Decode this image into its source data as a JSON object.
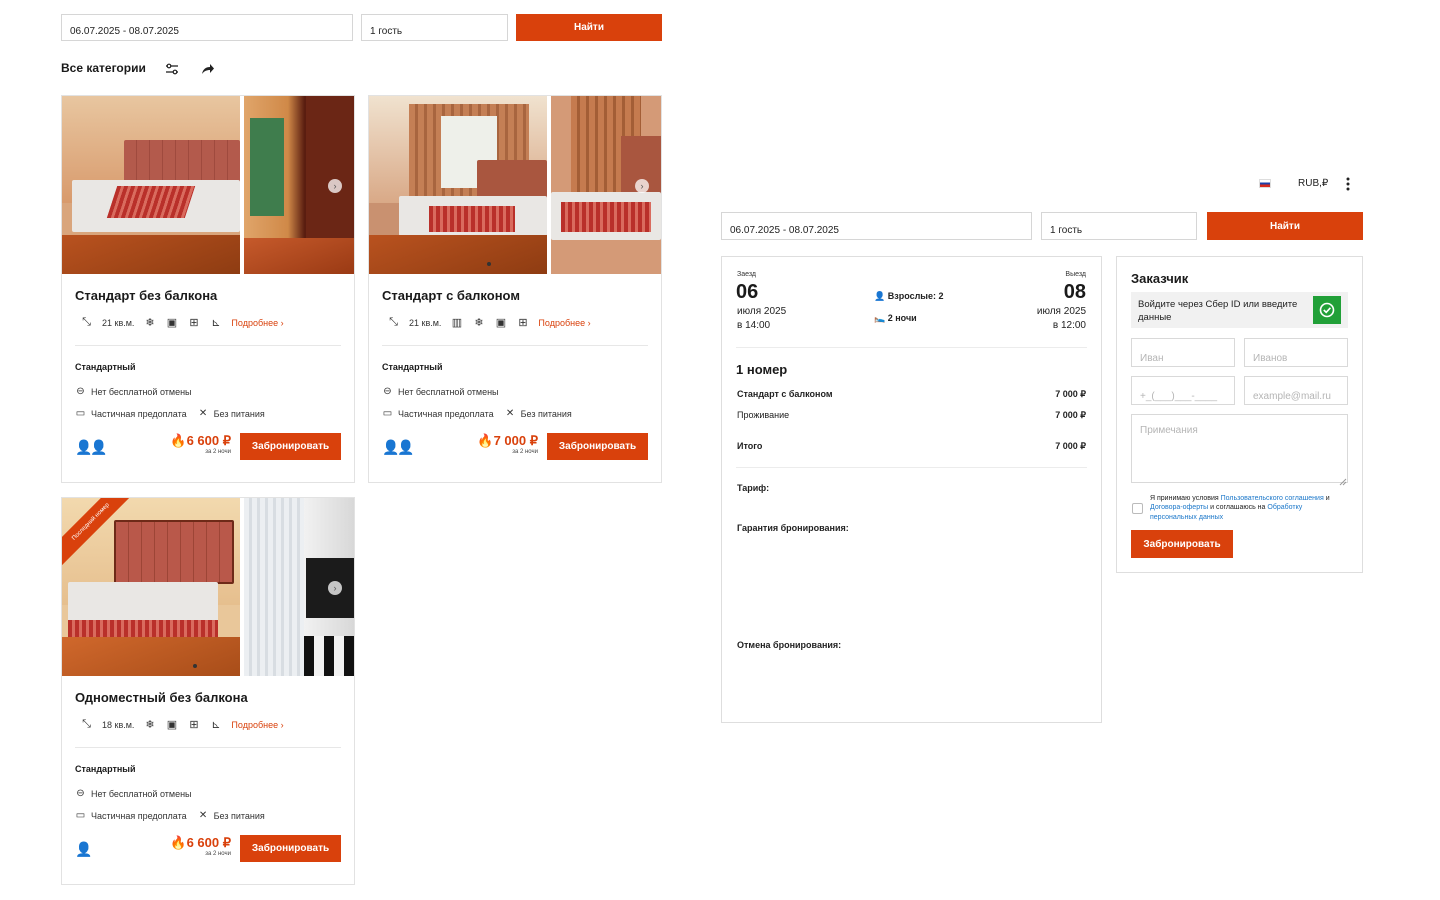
{
  "left_search": {
    "dates": "06.07.2025 - 08.07.2025",
    "guests": "1 гость",
    "find_label": "Найти"
  },
  "categories": {
    "title": "Все категории",
    "filter_icon": "sliders-icon",
    "share_icon": "share-arrow-icon"
  },
  "rooms": [
    {
      "title": "Стандарт без балкона",
      "area": "21 кв.м.",
      "amenity_icons": [
        "air-conditioner-icon",
        "safe-icon",
        "window-icon",
        "toilet-icon"
      ],
      "more": "Подробнее",
      "tariff": "Стандартный",
      "cancel": "Нет бесплатной отмены",
      "prepay": "Частичная предоплата",
      "meals": "Без питания",
      "guests_icons": "👥",
      "price": "6 600 ₽",
      "price_note": "за 2 ночи",
      "book": "Забронировать"
    },
    {
      "title": "Стандарт с балконом",
      "area": "21 кв.м.",
      "amenity_icons": [
        "balcony-icon",
        "air-conditioner-icon",
        "safe-icon",
        "window-icon"
      ],
      "more": "Подробнее",
      "tariff": "Стандартный",
      "cancel": "Нет бесплатной отмены",
      "prepay": "Частичная предоплата",
      "meals": "Без питания",
      "price": "7 000 ₽",
      "price_note": "за 2 ночи",
      "book": "Забронировать"
    },
    {
      "title": "Одноместный без балкона",
      "area": "18 кв.м.",
      "amenity_icons": [
        "air-conditioner-icon",
        "safe-icon",
        "window-icon",
        "toilet-icon"
      ],
      "more": "Подробнее",
      "tariff": "Стандартный",
      "cancel": "Нет бесплатной отмены",
      "prepay": "Частичная предоплата",
      "meals": "Без питания",
      "price": "6 600 ₽",
      "price_note": "за 2 ночи",
      "book": "Забронировать",
      "badge": "Последний номер"
    }
  ],
  "topbar": {
    "flag_icon": "russia-flag-icon",
    "currency": "RUB,₽",
    "menu_icon": "kebab-menu-icon"
  },
  "right_search": {
    "dates": "06.07.2025 - 08.07.2025",
    "guests": "1 гость",
    "find_label": "Найти"
  },
  "booking": {
    "checkin_label": "Заезд",
    "checkin_day": "06",
    "checkin_month": "июля 2025",
    "checkin_time": "в 14:00",
    "adults": "Взрослые: 2",
    "nights": "2 ночи",
    "checkout_label": "Выезд",
    "checkout_day": "08",
    "checkout_month": "июля 2025",
    "checkout_time": "в 12:00",
    "rooms_count": "1 номер",
    "room_name": "Стандарт с балконом",
    "room_price": "7 000 ₽",
    "stay_label": "Проживание",
    "stay_price": "7 000 ₽",
    "total_label": "Итого",
    "total_price": "7 000 ₽",
    "tariff_label": "Тариф:",
    "guarantee_label": "Гарантия бронирования:",
    "cancel_label": "Отмена бронирования:"
  },
  "customer": {
    "title": "Заказчик",
    "sber_text": "Войдите через Сбер ID или введите данные",
    "first_name_ph": "Иван",
    "last_name_ph": "Иванов",
    "phone_ph": "+_(___)___-____",
    "email_ph": "example@mail.ru",
    "notes_ph": "Примечания",
    "consent_1": "Я принимаю условия ",
    "consent_link_1": "Пользовательского соглашения",
    "consent_2": " и ",
    "consent_link_2": "Договора-оферты",
    "consent_3": " и соглашаюсь на ",
    "consent_link_3": "Обработку персональных данных",
    "submit": "Забронировать"
  },
  "colors": {
    "accent": "#d9410c",
    "link": "#1b77c9",
    "sber_green": "#21a038"
  }
}
